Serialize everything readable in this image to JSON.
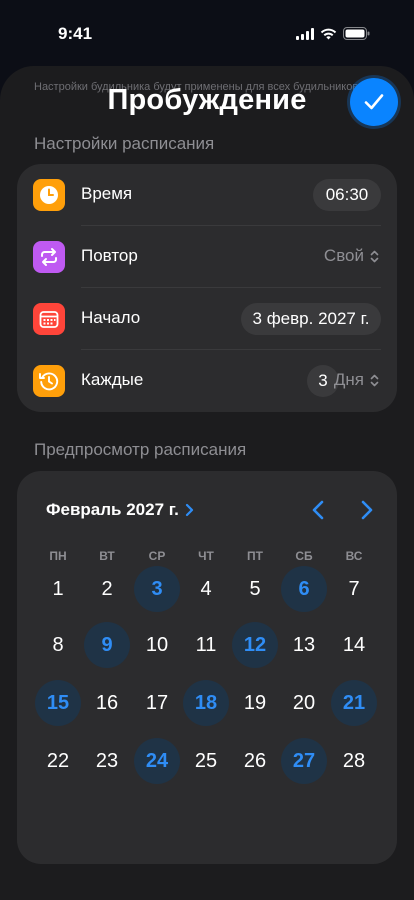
{
  "status_bar": {
    "time": "9:41"
  },
  "header": {
    "title": "Пробуждение",
    "behind_text": "Настройки будильника будут применены для всех будильников"
  },
  "schedule_settings": {
    "section_label": "Настройки расписания",
    "time": {
      "label": "Время",
      "value": "06:30"
    },
    "repeat": {
      "label": "Повтор",
      "value": "Свой"
    },
    "start": {
      "label": "Начало",
      "value": "3 февр. 2027 г."
    },
    "every": {
      "label": "Каждые",
      "number": "3",
      "unit": "Дня"
    }
  },
  "preview": {
    "section_label": "Предпросмотр расписания",
    "month_label": "Февраль 2027 г.",
    "weekdays": [
      "ПН",
      "ВТ",
      "СР",
      "ЧТ",
      "ПТ",
      "СБ",
      "ВС"
    ],
    "days": [
      {
        "n": "1",
        "sel": false
      },
      {
        "n": "2",
        "sel": false
      },
      {
        "n": "3",
        "sel": true
      },
      {
        "n": "4",
        "sel": false
      },
      {
        "n": "5",
        "sel": false
      },
      {
        "n": "6",
        "sel": true
      },
      {
        "n": "7",
        "sel": false
      },
      {
        "n": "8",
        "sel": false
      },
      {
        "n": "9",
        "sel": true
      },
      {
        "n": "10",
        "sel": false
      },
      {
        "n": "11",
        "sel": false
      },
      {
        "n": "12",
        "sel": true
      },
      {
        "n": "13",
        "sel": false
      },
      {
        "n": "14",
        "sel": false
      },
      {
        "n": "15",
        "sel": true
      },
      {
        "n": "16",
        "sel": false
      },
      {
        "n": "17",
        "sel": false
      },
      {
        "n": "18",
        "sel": true
      },
      {
        "n": "19",
        "sel": false
      },
      {
        "n": "20",
        "sel": false
      },
      {
        "n": "21",
        "sel": true
      },
      {
        "n": "22",
        "sel": false
      },
      {
        "n": "23",
        "sel": false
      },
      {
        "n": "24",
        "sel": true
      },
      {
        "n": "25",
        "sel": false
      },
      {
        "n": "26",
        "sel": false
      },
      {
        "n": "27",
        "sel": true
      },
      {
        "n": "28",
        "sel": false
      }
    ]
  },
  "colors": {
    "accent": "#0a84ff",
    "icon_time": "#ff9f0a",
    "icon_repeat": "#bf5af2",
    "icon_start": "#ff453a",
    "icon_every": "#ff9f0a"
  }
}
